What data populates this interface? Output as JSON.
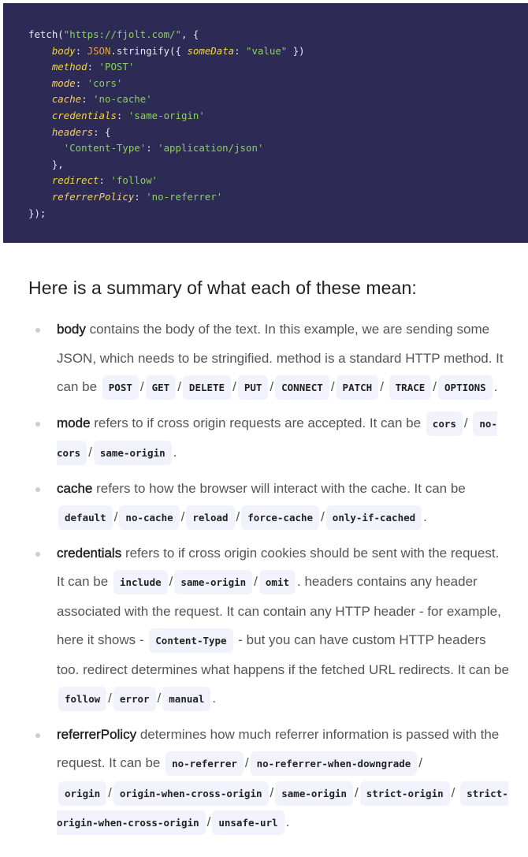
{
  "code_lines": [
    [
      [
        "p",
        "fetch("
      ],
      [
        "s",
        "\"https://fjolt.com/\""
      ],
      [
        "p",
        ", {"
      ]
    ],
    [
      [
        "p",
        "    "
      ],
      [
        "k",
        "body"
      ],
      [
        "p",
        ": "
      ],
      [
        "o",
        "JSON"
      ],
      [
        "p",
        ".stringify({ "
      ],
      [
        "k",
        "someData"
      ],
      [
        "p",
        ": "
      ],
      [
        "s",
        "\"value\""
      ],
      [
        "p",
        " })"
      ]
    ],
    [
      [
        "p",
        "    "
      ],
      [
        "k",
        "method"
      ],
      [
        "p",
        ": "
      ],
      [
        "s",
        "'POST'"
      ]
    ],
    [
      [
        "p",
        "    "
      ],
      [
        "k",
        "mode"
      ],
      [
        "p",
        ": "
      ],
      [
        "s",
        "'cors'"
      ]
    ],
    [
      [
        "p",
        "    "
      ],
      [
        "k",
        "cache"
      ],
      [
        "p",
        ": "
      ],
      [
        "s",
        "'no-cache'"
      ]
    ],
    [
      [
        "p",
        "    "
      ],
      [
        "k",
        "credentials"
      ],
      [
        "p",
        ": "
      ],
      [
        "s",
        "'same-origin'"
      ]
    ],
    [
      [
        "p",
        "    "
      ],
      [
        "k",
        "headers"
      ],
      [
        "p",
        ": {"
      ]
    ],
    [
      [
        "p",
        "      "
      ],
      [
        "s",
        "'Content-Type'"
      ],
      [
        "p",
        ": "
      ],
      [
        "s",
        "'application/json'"
      ]
    ],
    [
      [
        "p",
        "    },"
      ]
    ],
    [
      [
        "p",
        "    "
      ],
      [
        "k",
        "redirect"
      ],
      [
        "p",
        ": "
      ],
      [
        "s",
        "'follow'"
      ]
    ],
    [
      [
        "p",
        "    "
      ],
      [
        "k",
        "referrerPolicy"
      ],
      [
        "p",
        ": "
      ],
      [
        "s",
        "'no-referrer'"
      ]
    ],
    [
      [
        "p",
        "});"
      ]
    ]
  ],
  "heading": "Here is a summary of what each of these mean:",
  "items": [
    [
      [
        "b",
        "body"
      ],
      [
        "t",
        " contains the body of the text. In this example, we are sending some JSON, which needs to be stringified. method is a standard HTTP method. It can be "
      ],
      [
        "c",
        "POST"
      ],
      [
        "t",
        "/"
      ],
      [
        "c",
        "GET"
      ],
      [
        "t",
        "/"
      ],
      [
        "c",
        "DELETE"
      ],
      [
        "t",
        "/"
      ],
      [
        "c",
        "PUT"
      ],
      [
        "t",
        "/"
      ],
      [
        "c",
        "CONNECT"
      ],
      [
        "t",
        "/"
      ],
      [
        "c",
        "PATCH"
      ],
      [
        "t",
        "/ "
      ],
      [
        "c",
        "TRACE"
      ],
      [
        "t",
        "/"
      ],
      [
        "c",
        "OPTIONS"
      ],
      [
        "t",
        "."
      ]
    ],
    [
      [
        "b",
        "mode"
      ],
      [
        "t",
        " refers to if cross origin requests are accepted. It can be "
      ],
      [
        "c",
        "cors"
      ],
      [
        "t",
        "/ "
      ],
      [
        "c",
        "no-cors"
      ],
      [
        "t",
        "/"
      ],
      [
        "c",
        "same-origin"
      ],
      [
        "t",
        "."
      ]
    ],
    [
      [
        "b",
        "cache"
      ],
      [
        "t",
        " refers to how the browser will interact with the cache. It can be "
      ],
      [
        "c",
        "default"
      ],
      [
        "t",
        "/"
      ],
      [
        "c",
        "no-cache"
      ],
      [
        "t",
        "/"
      ],
      [
        "c",
        "reload"
      ],
      [
        "t",
        "/"
      ],
      [
        "c",
        "force-cache"
      ],
      [
        "t",
        "/"
      ],
      [
        "c",
        "only-if-cached"
      ],
      [
        "t",
        "."
      ]
    ],
    [
      [
        "b",
        "credentials"
      ],
      [
        "t",
        " refers to if cross origin cookies should be sent with the request. It can be "
      ],
      [
        "c",
        "include"
      ],
      [
        "t",
        "/"
      ],
      [
        "c",
        "same-origin"
      ],
      [
        "t",
        "/"
      ],
      [
        "c",
        "omit"
      ],
      [
        "t",
        ". headers contains any header associated with the request. It can contain any HTTP header - for example, here it shows - "
      ],
      [
        "c",
        "Content-Type"
      ],
      [
        "t",
        " - but you can have custom HTTP headers too. redirect determines what happens if the fetched URL redirects. It can be "
      ],
      [
        "c",
        "follow"
      ],
      [
        "t",
        "/"
      ],
      [
        "c",
        "error"
      ],
      [
        "t",
        "/"
      ],
      [
        "c",
        "manual"
      ],
      [
        "t",
        "."
      ]
    ],
    [
      [
        "b",
        "referrerPolicy"
      ],
      [
        "t",
        " determines how much referrer information is passed with the request. It can be "
      ],
      [
        "c",
        "no-referrer"
      ],
      [
        "t",
        "/"
      ],
      [
        "c",
        "no-referrer-when-downgrade"
      ],
      [
        "t",
        "/ "
      ],
      [
        "c",
        "origin"
      ],
      [
        "t",
        "/"
      ],
      [
        "c",
        "origin-when-cross-origin"
      ],
      [
        "t",
        "/"
      ],
      [
        "c",
        "same-origin"
      ],
      [
        "t",
        "/"
      ],
      [
        "c",
        "strict-origin"
      ],
      [
        "t",
        "/ "
      ],
      [
        "c",
        "strict-origin-when-cross-origin"
      ],
      [
        "t",
        "/"
      ],
      [
        "c",
        "unsafe-url"
      ],
      [
        "t",
        "."
      ]
    ]
  ]
}
